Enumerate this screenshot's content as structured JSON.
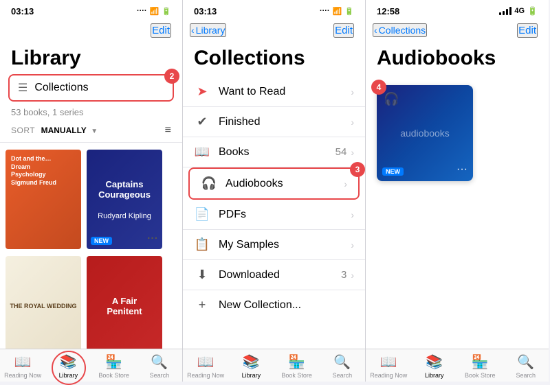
{
  "panel1": {
    "status": {
      "time": "03:13",
      "signal": "····",
      "wifi": "WiFi",
      "battery": "Battery"
    },
    "nav": {
      "edit": "Edit"
    },
    "title": "Library",
    "collections_label": "Collections",
    "books_count": "53 books, 1 series",
    "sort_prefix": "SORT",
    "sort_mode": "MANUALLY",
    "badge": "2",
    "books": [
      {
        "title": "Dot and the…\nDream\nPsychology\nSigmund Freud",
        "style": "orange"
      },
      {
        "title": "Captains\nCourageous\n\nRudyard Kipling",
        "style": "navy"
      }
    ],
    "books2": [
      {
        "title": "THE ROYAL WEDDING",
        "style": "beige"
      },
      {
        "title": "A Fair\nPenitent",
        "style": "red"
      }
    ]
  },
  "panel1_tabs": [
    {
      "label": "Reading Now",
      "icon": "📖",
      "active": false
    },
    {
      "label": "Library",
      "icon": "📚",
      "active": true
    },
    {
      "label": "Book Store",
      "icon": "🏪",
      "active": false
    },
    {
      "label": "Search",
      "icon": "🔍",
      "active": false
    }
  ],
  "panel2": {
    "status": {
      "time": "03:13"
    },
    "nav": {
      "back": "Library",
      "edit": "Edit"
    },
    "title": "Collections",
    "badge": "3",
    "items": [
      {
        "icon": "➡️",
        "name": "Want to Read",
        "count": "",
        "chevron": "›"
      },
      {
        "icon": "✅",
        "name": "Finished",
        "count": "",
        "chevron": "›"
      },
      {
        "icon": "📖",
        "name": "Books",
        "count": "54",
        "chevron": "›"
      },
      {
        "icon": "🎧",
        "name": "Audiobooks",
        "count": "",
        "chevron": "›",
        "highlighted": true
      },
      {
        "icon": "📄",
        "name": "PDFs",
        "count": "",
        "chevron": "›"
      },
      {
        "icon": "📋",
        "name": "My Samples",
        "count": "",
        "chevron": "›"
      },
      {
        "icon": "⬇",
        "name": "Downloaded",
        "count": "3",
        "chevron": "›"
      }
    ],
    "new_collection": "New Collection..."
  },
  "panel2_tabs": [
    {
      "label": "Reading Now",
      "icon": "📖",
      "active": false
    },
    {
      "label": "Library",
      "icon": "📚",
      "active": true
    },
    {
      "label": "Book Store",
      "icon": "🏪",
      "active": false
    },
    {
      "label": "Search",
      "icon": "🔍",
      "active": false
    }
  ],
  "panel3": {
    "status": {
      "time": "12:58"
    },
    "nav": {
      "back": "Collections",
      "edit": "Edit"
    },
    "title": "Audiobooks",
    "badge": "4",
    "cover_label": "audiobooks"
  },
  "panel3_tabs": [
    {
      "label": "Reading Now",
      "icon": "📖",
      "active": false
    },
    {
      "label": "Library",
      "icon": "📚",
      "active": true
    },
    {
      "label": "Book Store",
      "icon": "🏪",
      "active": false
    },
    {
      "label": "Search",
      "icon": "🔍",
      "active": false
    }
  ]
}
